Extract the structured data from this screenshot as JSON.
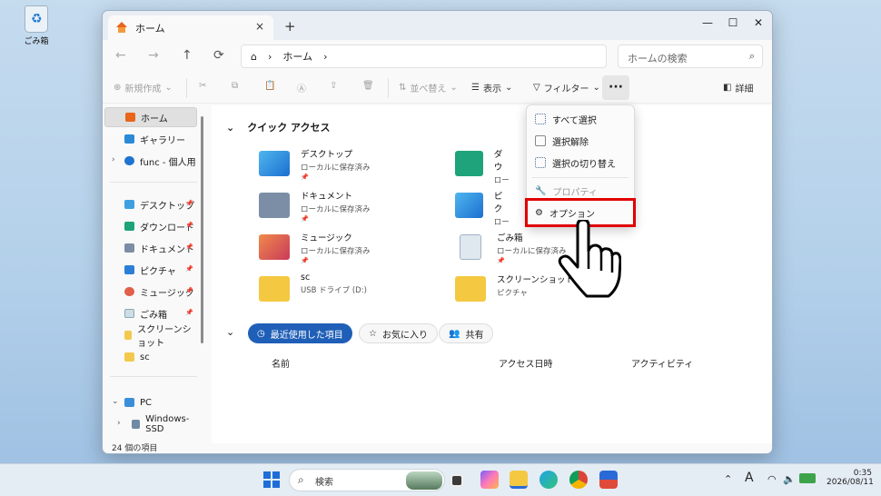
{
  "desktop": {
    "recycle_bin_label": "ごみ箱"
  },
  "window": {
    "tab_title": "ホーム",
    "tab_close": "×",
    "new_tab": "+",
    "controls": {
      "minimize": "—",
      "maximize": "☐",
      "close": "✕"
    }
  },
  "nav": {
    "back": "←",
    "forward": "→",
    "up": "↑",
    "refresh": "⟳",
    "breadcrumb": [
      "ホーム"
    ],
    "search_placeholder": "ホームの検索"
  },
  "commandbar": {
    "new": "新規作成",
    "sort": "並べ替え",
    "view": "表示",
    "filter": "フィルター",
    "more": "···",
    "details": "詳細"
  },
  "sidebar": {
    "items": [
      {
        "label": "ホーム",
        "selected": true
      },
      {
        "label": "ギャラリー"
      },
      {
        "label": "func - 個人用",
        "expandable": true
      }
    ],
    "pinned": [
      {
        "label": "デスクトップ",
        "pinned": true
      },
      {
        "label": "ダウンロード",
        "pinned": true
      },
      {
        "label": "ドキュメント",
        "pinned": true
      },
      {
        "label": "ピクチャ",
        "pinned": true
      },
      {
        "label": "ミュージック",
        "pinned": true
      },
      {
        "label": "ごみ箱",
        "pinned": true
      },
      {
        "label": "スクリーンショット"
      },
      {
        "label": "sc"
      }
    ],
    "devices": [
      {
        "label": "PC"
      },
      {
        "label": "Windows-SSD"
      }
    ]
  },
  "quick_access": {
    "title": "クイック アクセス",
    "items": [
      {
        "name": "デスクトップ",
        "sub": "ローカルに保存済み"
      },
      {
        "name": "ダウ",
        "sub": "ロー"
      },
      {
        "name": "ドキュメント",
        "sub": "ローカルに保存済み"
      },
      {
        "name": "ピク",
        "sub": "ロー"
      },
      {
        "name": "ミュージック",
        "sub": "ローカルに保存済み"
      },
      {
        "name": "ごみ箱",
        "sub": "ローカルに保存済み"
      },
      {
        "name": "sc",
        "sub": "USB ドライブ (D:)"
      },
      {
        "name": "スクリーンショット",
        "sub": "ピクチャ"
      }
    ]
  },
  "recent": {
    "tabs": [
      "最近使用した項目",
      "お気に入り",
      "共有"
    ],
    "columns": [
      "名前",
      "アクセス日時",
      "アクティビティ"
    ]
  },
  "status": "24 個の項目",
  "context_menu": {
    "items": [
      {
        "label": "すべて選択",
        "disabled": false
      },
      {
        "label": "選択解除",
        "disabled": false
      },
      {
        "label": "選択の切り替え",
        "disabled": false
      },
      {
        "label": "プロパティ",
        "disabled": true
      },
      {
        "label": "オプション",
        "disabled": false,
        "highlighted": true
      }
    ]
  },
  "taskbar": {
    "search_label": "検索",
    "ime": "A",
    "time": "0:35",
    "date": "2026/08/11"
  },
  "colors": {
    "accent": "#1f5fb8",
    "highlight_box": "#e00000"
  }
}
